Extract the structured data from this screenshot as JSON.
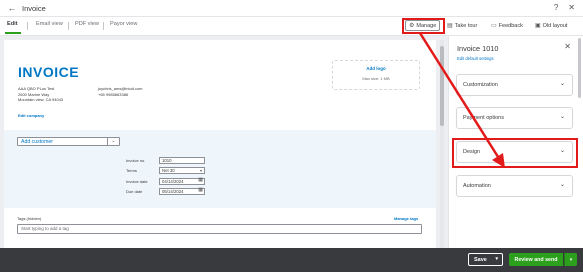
{
  "window": {
    "title": "Invoice",
    "back_icon": "←",
    "help_icon": "?",
    "close_icon": "✕"
  },
  "tabs": [
    {
      "label": "Edit",
      "active": true
    },
    {
      "label": "Email view",
      "active": false
    },
    {
      "label": "PDF view",
      "active": false
    },
    {
      "label": "Payor view",
      "active": false
    }
  ],
  "toolbar": {
    "manage_label": "Manage",
    "tour_label": "Take tour",
    "feedback_label": "Feedback",
    "layout_label": "Old layout"
  },
  "invoice": {
    "heading": "INVOICE",
    "logo_add": "Add logo",
    "logo_size": "Max size: 1 MB",
    "address": [
      "AAA QBO PLus Test",
      "2600 Marine Way",
      "Mountain view, CA 94043"
    ],
    "contact": [
      "joychris_ams@intuit.com",
      "+65 9985863386"
    ],
    "edit_company": "Edit company",
    "customer_placeholder": "Add customer",
    "fields": [
      {
        "label": "Invoice no.",
        "value": "1010"
      },
      {
        "label": "Terms",
        "value": "Net 30"
      },
      {
        "label": "Invoice date",
        "value": "04/14/2024"
      },
      {
        "label": "Due date",
        "value": "05/14/2024"
      }
    ],
    "tags_label": "Tags (hidden)",
    "manage_tags": "Manage tags",
    "tags_placeholder": "Start typing to add a tag"
  },
  "panel": {
    "title": "Invoice 1010",
    "subtitle": "Edit default settings",
    "sections": [
      {
        "label": "Customization"
      },
      {
        "label": "Payment options"
      },
      {
        "label": "Design"
      },
      {
        "label": "Automation"
      }
    ]
  },
  "footer": {
    "save_label": "Save",
    "review_label": "Review and send"
  },
  "colors": {
    "accent": "#0077c5",
    "primary": "#2ca01c",
    "highlight": "#e31a1a",
    "footer": "#393a3d"
  }
}
